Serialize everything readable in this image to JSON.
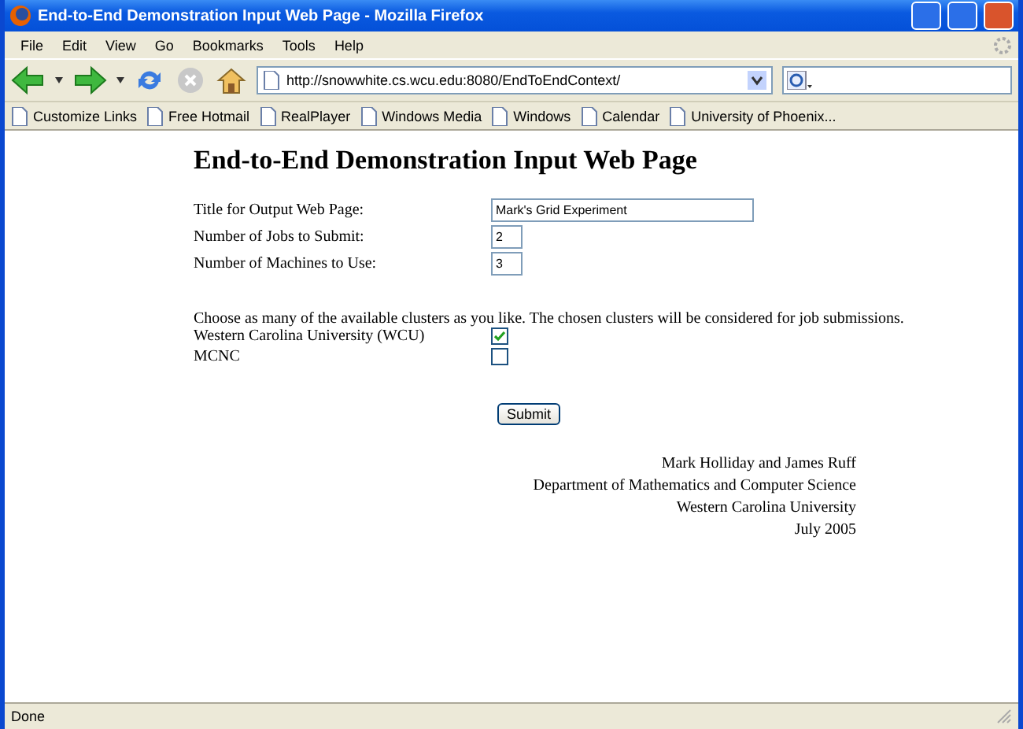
{
  "window": {
    "title": "End-to-End Demonstration Input Web Page - Mozilla Firefox"
  },
  "menu": [
    "File",
    "Edit",
    "View",
    "Go",
    "Bookmarks",
    "Tools",
    "Help"
  ],
  "address": {
    "value": "http://snowwhite.cs.wcu.edu:8080/EndToEndContext/"
  },
  "bookmarks": [
    "Customize Links",
    "Free Hotmail",
    "RealPlayer",
    "Windows Media",
    "Windows",
    "Calendar",
    "University of Phoenix..."
  ],
  "page": {
    "heading": "End-to-End Demonstration Input Web Page",
    "fields": [
      {
        "label": "Title for Output Web Page:",
        "value": "Mark's Grid Experiment",
        "kind": "wide"
      },
      {
        "label": "Number of Jobs to Submit:",
        "value": "2",
        "kind": "short"
      },
      {
        "label": "Number of Machines to Use:",
        "value": "3",
        "kind": "short"
      }
    ],
    "instructions": "Choose as many of the available clusters as you like. The chosen clusters will be considered for job submissions.",
    "clusters": [
      {
        "label": "Western Carolina University (WCU)",
        "checked": true
      },
      {
        "label": "MCNC",
        "checked": false
      }
    ],
    "submit": "Submit",
    "credits": [
      "Mark Holliday and James Ruff",
      "Department of Mathematics and Computer Science",
      "Western Carolina University",
      "July 2005"
    ]
  },
  "status_bar": {
    "text": "Done"
  }
}
